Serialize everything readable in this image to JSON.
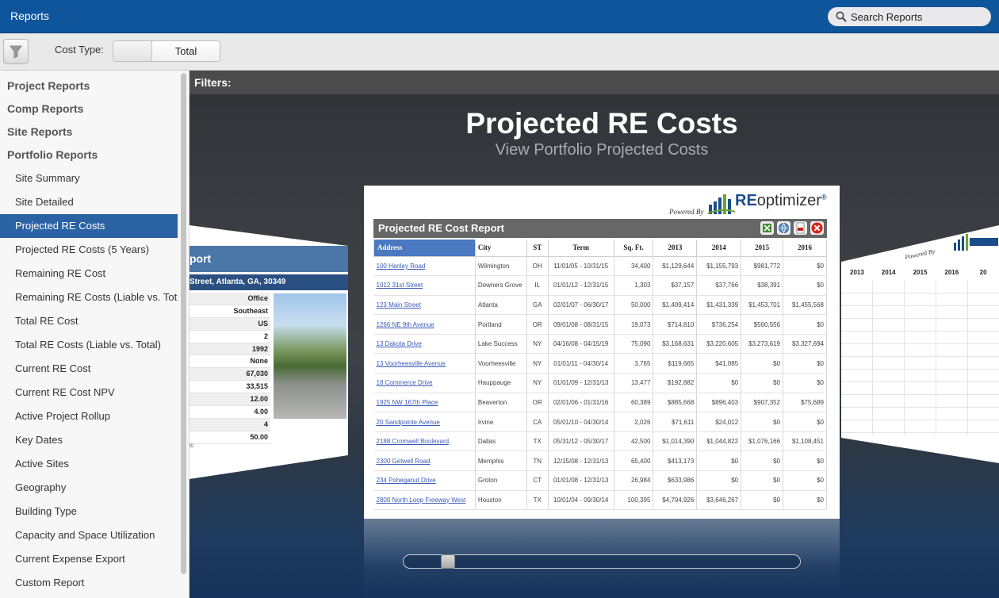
{
  "app": {
    "title": "Reports"
  },
  "search": {
    "placeholder": "Search Reports"
  },
  "toolbar": {
    "cost_type_label": "Cost Type:",
    "cost_type_options": [
      "",
      "Total"
    ]
  },
  "sidebar": {
    "sections": [
      {
        "label": "Project Reports"
      },
      {
        "label": "Comp Reports"
      },
      {
        "label": "Site Reports"
      },
      {
        "label": "Portfolio Reports"
      }
    ],
    "items": [
      "Site Summary",
      "Site Detailed",
      "Projected RE Costs",
      "Projected RE Costs (5 Years)",
      "Remaining RE Cost",
      "Remaining RE Costs (Liable vs. Total)",
      "Total RE Cost",
      "Total RE Costs (Liable vs. Total)",
      "Current RE Cost",
      "Current RE Cost NPV",
      "Active Project Rollup",
      "Key Dates",
      "Active Sites",
      "Geography",
      "Building Type",
      "Capacity and Space Utilization",
      "Current Expense Export",
      "Custom Report"
    ],
    "active_item": "Projected RE Costs"
  },
  "main": {
    "filters_label": "Filters:",
    "title": "Projected RE Costs",
    "subtitle": "View Portfolio Projected Costs"
  },
  "left_card": {
    "head": "port",
    "address": "Street, Atlanta, GA, 30349",
    "values": [
      "Office",
      "Southeast",
      "US",
      "2",
      "1992",
      "None",
      "67,030",
      "33,515",
      "12.00",
      "4.00",
      "4",
      "50.00"
    ],
    "partial_label": "s:"
  },
  "right_card": {
    "powered_by": "Powered By",
    "years": [
      "2013",
      "2014",
      "2015",
      "2016",
      "20"
    ]
  },
  "report": {
    "powered_by": "Powered By",
    "logo": {
      "text_re": "RE",
      "text_rest": "optimizer",
      "mark": "®"
    },
    "title": "Projected RE Cost Report",
    "icons": [
      "excel-export-icon",
      "globe-icon",
      "pdf-icon",
      "close-icon"
    ],
    "colors": {
      "header_blue": "#4a78c1",
      "link": "#3a5ab9",
      "title_bar": "#676767",
      "accent": "#2a62a4",
      "top_bar": "#0f559c"
    },
    "columns": [
      "Address",
      "City",
      "ST",
      "Term",
      "Sq. Ft.",
      "2013",
      "2014",
      "2015",
      "2016"
    ],
    "rows": [
      [
        "100 Hanley Road",
        "Wilmington",
        "OH",
        "11/01/05 - 10/31/15",
        "34,400",
        "$1,129,644",
        "$1,155,793",
        "$981,772",
        "$0"
      ],
      [
        "1012 31st Street",
        "Downers Grove",
        "IL",
        "01/01/12 - 12/31/15",
        "1,303",
        "$37,157",
        "$37,766",
        "$38,391",
        "$0"
      ],
      [
        "123 Main Street",
        "Atlanta",
        "GA",
        "02/01/07 - 06/30/17",
        "50,000",
        "$1,409,414",
        "$1,431,339",
        "$1,453,701",
        "$1,455,568"
      ],
      [
        "1266 NE 9th Avenue",
        "Portland",
        "OR",
        "09/01/08 - 08/31/15",
        "19,073",
        "$714,810",
        "$736,254",
        "$500,556",
        "$0"
      ],
      [
        "13 Dakota Drive",
        "Lake Success",
        "NY",
        "04/16/08 - 04/15/19",
        "75,090",
        "$3,168,631",
        "$3,220,605",
        "$3,273,619",
        "$3,327,694"
      ],
      [
        "13 Voorheesville Avenue",
        "Voorheesville",
        "NY",
        "01/01/11 - 04/30/14",
        "3,765",
        "$119,665",
        "$41,085",
        "$0",
        "$0"
      ],
      [
        "18 Commerce Drive",
        "Hauppauge",
        "NY",
        "01/01/09 - 12/31/13",
        "13,477",
        "$192,882",
        "$0",
        "$0",
        "$0"
      ],
      [
        "1925 NW 167th Place",
        "Beaverton",
        "OR",
        "02/01/06 - 01/31/16",
        "60,389",
        "$885,668",
        "$896,403",
        "$907,352",
        "$75,689"
      ],
      [
        "20 Sandpointe Avenue",
        "Irvine",
        "CA",
        "05/01/10 - 04/30/14",
        "2,026",
        "$71,611",
        "$24,012",
        "$0",
        "$0"
      ],
      [
        "2188 Cromwell Boulevard",
        "Dallas",
        "TX",
        "05/31/12 - 05/30/17",
        "42,500",
        "$1,014,390",
        "$1,044,822",
        "$1,076,166",
        "$1,108,451"
      ],
      [
        "2300 Getwell Road",
        "Memphis",
        "TN",
        "12/15/08 - 12/31/13",
        "65,400",
        "$413,173",
        "$0",
        "$0",
        "$0"
      ],
      [
        "234 Poheganut Drive",
        "Groton",
        "CT",
        "01/01/08 - 12/31/13",
        "26,984",
        "$633,986",
        "$0",
        "$0",
        "$0"
      ],
      [
        "2800 North Loop Freeway West",
        "Houston",
        "TX",
        "10/01/04 - 09/30/14",
        "100,395",
        "$4,704,926",
        "$3,646,267",
        "$0",
        "$0"
      ]
    ]
  }
}
